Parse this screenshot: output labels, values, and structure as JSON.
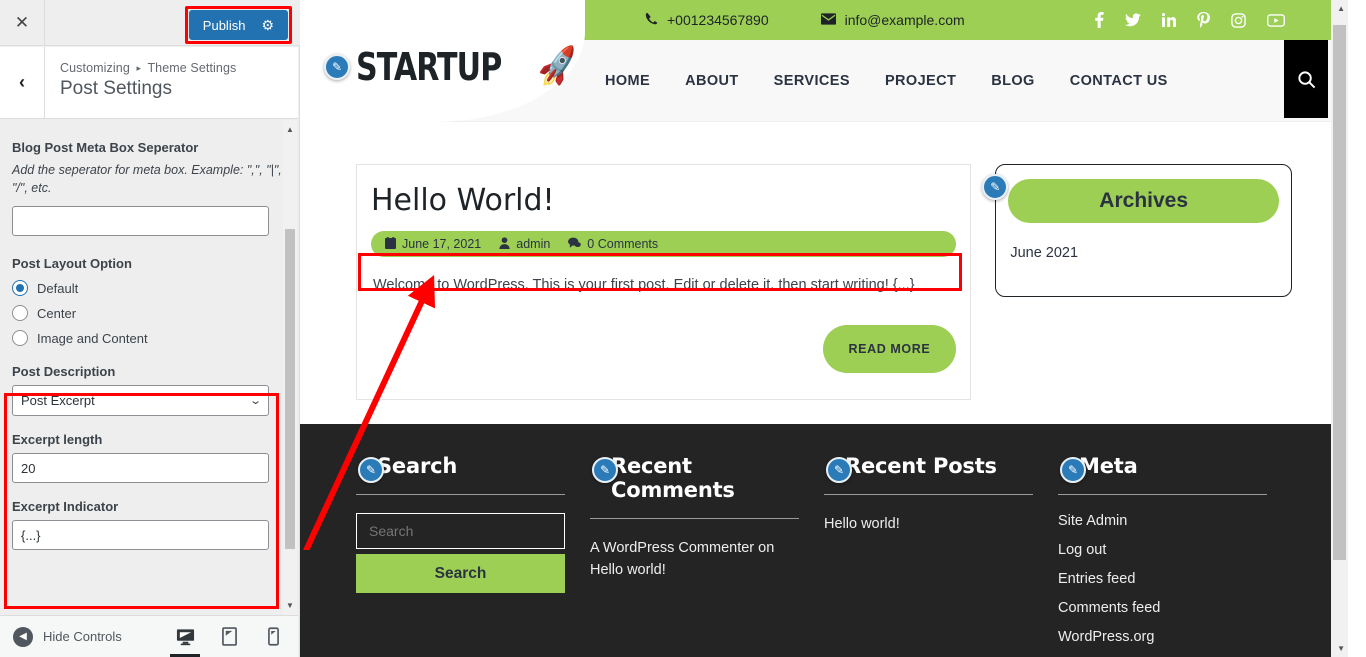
{
  "customizer": {
    "close_icon": "close-icon",
    "publish_label": "Publish",
    "gear_icon": "gear-icon",
    "back_icon": "chevron-left-icon",
    "breadcrumb_root": "Customizing",
    "breadcrumb_sep": "▸",
    "breadcrumb_current": "Theme Settings",
    "panel_title": "Post Settings",
    "controls": {
      "separator_label": "Blog Post Meta Box Seperator",
      "separator_desc": "Add the seperator for meta box. Example: \",\", \"|\", \"/\", etc.",
      "separator_value": "",
      "layout_label": "Post Layout Option",
      "layout_options": [
        {
          "label": "Default",
          "selected": true
        },
        {
          "label": "Center",
          "selected": false
        },
        {
          "label": "Image and Content",
          "selected": false
        }
      ],
      "description_label": "Post Description",
      "description_value": "Post Excerpt",
      "excerpt_length_label": "Excerpt length",
      "excerpt_length_value": "20",
      "excerpt_indicator_label": "Excerpt Indicator",
      "excerpt_indicator_value": "{...}"
    },
    "footer": {
      "hide_controls_label": "Hide Controls",
      "devices": [
        "desktop-icon",
        "tablet-icon",
        "mobile-icon"
      ]
    }
  },
  "site": {
    "topbar": {
      "phone": "+001234567890",
      "email": "info@example.com",
      "phone_icon": "phone-icon",
      "email_icon": "envelope-icon",
      "socials": [
        "facebook-icon",
        "twitter-icon",
        "linkedin-icon",
        "pinterest-icon",
        "instagram-icon",
        "youtube-icon"
      ]
    },
    "logo_text": "STARTUP",
    "logo_icon": "rocket-icon",
    "nav": [
      "HOME",
      "ABOUT",
      "SERVICES",
      "PROJECT",
      "BLOG",
      "CONTACT US"
    ],
    "search_icon": "search-icon",
    "post": {
      "title": "Hello World!",
      "date": "June 17, 2021",
      "author": "admin",
      "comments": "0 Comments",
      "date_icon": "calendar-icon",
      "author_icon": "user-icon",
      "comments_icon": "comment-icon",
      "excerpt": "Welcome to WordPress. This is your first post. Edit or delete it, then start writing! {...}",
      "read_more": "READ MORE"
    },
    "archives_widget": {
      "title": "Archives",
      "items": [
        "June 2021"
      ]
    },
    "footer_widgets": [
      {
        "title": "Search",
        "search_placeholder": "Search",
        "search_button": "Search",
        "items": []
      },
      {
        "title": "Recent Comments",
        "items": [
          "A WordPress Commenter on Hello world!"
        ]
      },
      {
        "title": "Recent Posts",
        "items": [
          "Hello world!"
        ]
      },
      {
        "title": "Meta",
        "items": [
          "Site Admin",
          "Log out",
          "Entries feed",
          "Comments feed",
          "WordPress.org"
        ]
      }
    ]
  },
  "colors": {
    "brand_green": "#9ccf53",
    "footer_dark": "#242424",
    "publish_blue": "#2271b1",
    "pencil_blue": "#2b7bb9",
    "annotation_red": "#ff0000"
  }
}
